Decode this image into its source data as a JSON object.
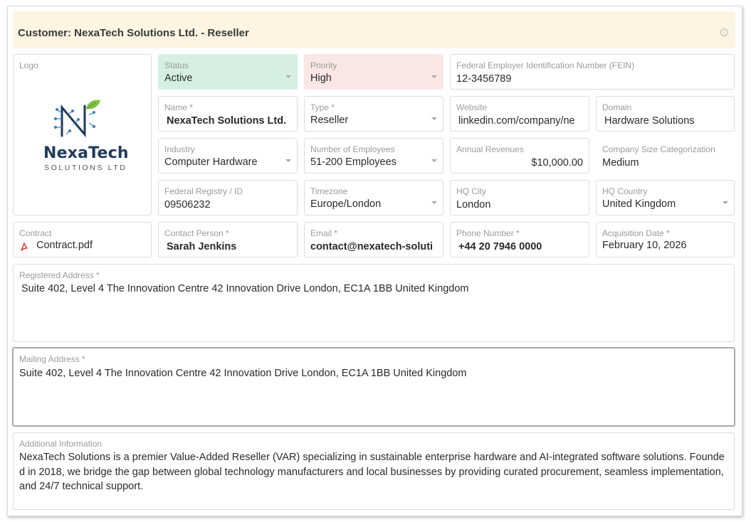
{
  "header": {
    "title": "Customer:  NexaTech Solutions Ltd. - Reseller"
  },
  "logo": {
    "label": "Logo",
    "line1": "NexaTech",
    "line2": "SOLUTIONS LTD"
  },
  "status": {
    "label": "Status",
    "value": "Active",
    "color": "#d5f0e3"
  },
  "priority": {
    "label": "Priority",
    "value": "High",
    "color": "#fbe6e6"
  },
  "fein": {
    "label": "Federal Employer Identification Number (FEIN)",
    "value": "12-3456789"
  },
  "name": {
    "label": "Name *",
    "value": "NexaTech Solutions Ltd."
  },
  "type": {
    "label": "Type *",
    "value": "Reseller"
  },
  "website": {
    "label": "Website",
    "value": "linkedin.com/company/ne"
  },
  "domain": {
    "label": "Domain",
    "value": "Hardware Solutions"
  },
  "industry": {
    "label": "Industry",
    "value": "Computer Hardware"
  },
  "employees": {
    "label": "Number of Employees",
    "value": "51-200 Employees"
  },
  "revenues": {
    "label": "Annual Revenues",
    "value": "$10,000.00"
  },
  "size": {
    "label": "Company Size Categorization",
    "value": "Medium"
  },
  "registry": {
    "label": "Federal Registry / ID",
    "value": "09506232"
  },
  "timezone": {
    "label": "Timezone",
    "value": "Europe/London"
  },
  "hq_city": {
    "label": "HQ City",
    "value": "London"
  },
  "hq_country": {
    "label": "HQ Country",
    "value": "United Kingdom"
  },
  "contract": {
    "label": "Contract",
    "value": "Contract.pdf",
    "icon": "pdf-icon"
  },
  "contact": {
    "label": "Contact Person *",
    "value": "Sarah Jenkins"
  },
  "email": {
    "label": "Email *",
    "value": "contact@nexatech-soluti"
  },
  "phone": {
    "label": "Phone Number *",
    "value": "+44 20 7946 0000"
  },
  "acq_date": {
    "label": "Acquisition Date *",
    "value": "February 10, 2026"
  },
  "registered_address": {
    "label": "Registered Address *",
    "value": "Suite 402, Level 4 The Innovation Centre 42 Innovation Drive London, EC1A 1BB United Kingdom"
  },
  "mailing_address": {
    "label": "Mailing Address *",
    "value": "Suite 402, Level 4 The Innovation Centre 42 Innovation Drive London, EC1A 1BB United Kingdom"
  },
  "additional": {
    "label": "Additional Information",
    "value": "NexaTech Solutions is a premier Value-Added Reseller (VAR) specializing in sustainable enterprise hardware and AI-integrated software solutions. Founded in 2018, we bridge the gap between global technology manufacturers and local businesses by providing curated procurement, seamless implementation, and 24/7 technical support."
  }
}
